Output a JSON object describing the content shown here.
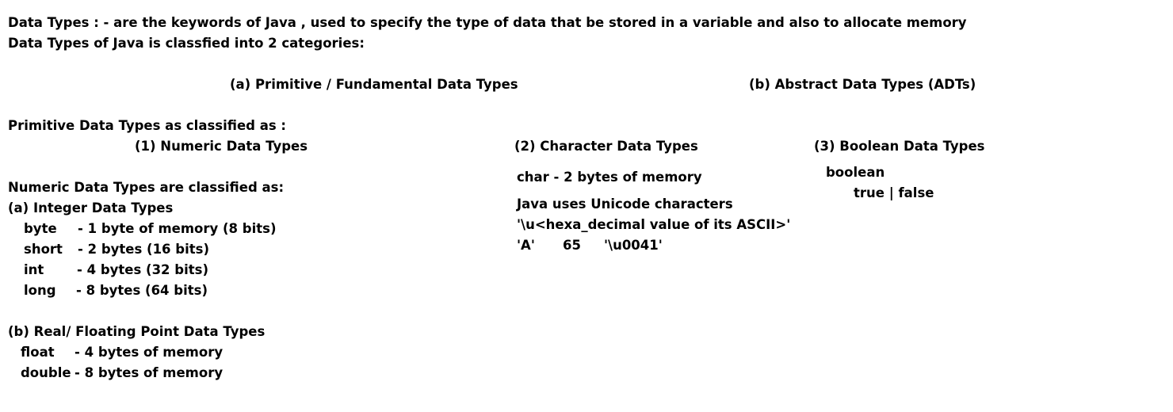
{
  "intro": {
    "line1": "Data Types : - are the keywords of Java , used to specify the type of data that be stored in a variable and also to allocate memory",
    "line2": "Data Types of Java is classfied into 2 categories:"
  },
  "categories": {
    "primitive": "(a) Primitive / Fundamental Data Types",
    "abstract": "(b) Abstract Data Types (ADTs)"
  },
  "primitive_intro": "Primitive Data Types as classified as :",
  "numeric": {
    "heading": "(1) Numeric Data Types",
    "classified_label": "Numeric Data Types are classified as:",
    "integer": {
      "heading": "(a) Integer Data Types",
      "rows": [
        {
          "type": "byte",
          "desc": "- 1 byte of memory (8 bits)"
        },
        {
          "type": "short",
          "desc": "- 2 bytes (16 bits)"
        },
        {
          "type": "int",
          "desc": "- 4 bytes (32 bits)"
        },
        {
          "type": "long",
          "desc": "- 8 bytes (64 bits)"
        }
      ]
    },
    "real": {
      "heading": "(b) Real/ Floating Point Data Types",
      "rows": [
        {
          "type": "float",
          "desc": "- 4 bytes of memory"
        },
        {
          "type": "double",
          "desc": "- 8 bytes of memory"
        }
      ]
    }
  },
  "character": {
    "heading": "(2) Character Data Types",
    "char_line": "char - 2 bytes of memory",
    "unicode_line": "Java uses Unicode characters",
    "format_line": "'\\u<hexa_decimal value of its ASCII>'",
    "example": {
      "char": "'A'",
      "ascii": "65",
      "unicode": "'\\u0041'"
    }
  },
  "boolean": {
    "heading": "(3) Boolean Data Types",
    "keyword": "boolean",
    "values": "true | false"
  }
}
